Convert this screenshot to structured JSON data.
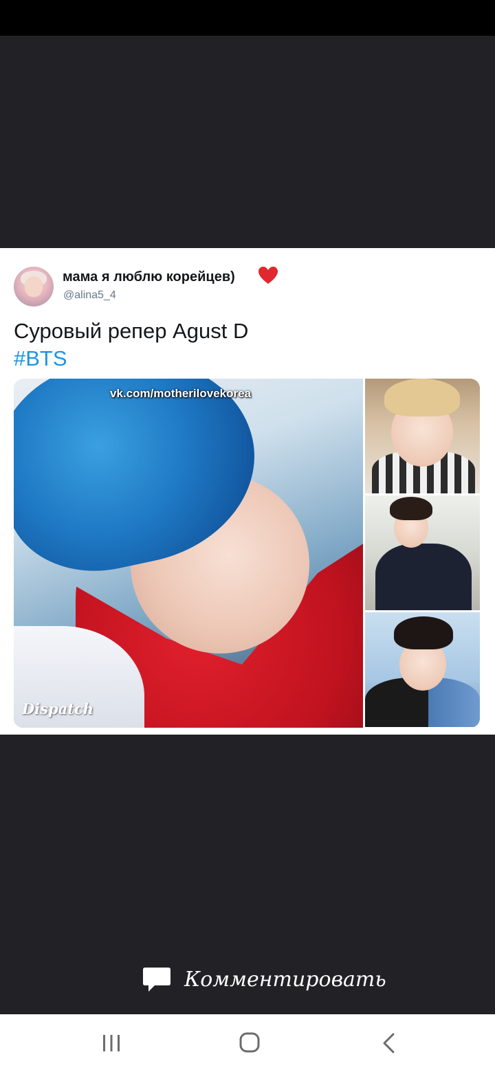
{
  "tweet": {
    "user_name": "мама я люблю корейцев)",
    "user_handle": "@alina5_4",
    "text": "Суровый репер Agust D",
    "hashtag": "#BTS",
    "media": {
      "watermark": "vk.com/motherilovekorea",
      "credit_logo": "Dispatch"
    }
  },
  "icons": {
    "verified_emoji": "heart-icon",
    "comment": "comment-bubble-icon",
    "nav": [
      "recents-icon",
      "home-icon",
      "back-icon"
    ]
  },
  "viewer": {
    "comment_label": "Комментировать"
  },
  "colors": {
    "background": "#222125",
    "card": "#ffffff",
    "hashtag": "#1b95e0",
    "handle": "#657786",
    "heart": "#e0282e",
    "nav_icons": "#6b6b6b"
  }
}
